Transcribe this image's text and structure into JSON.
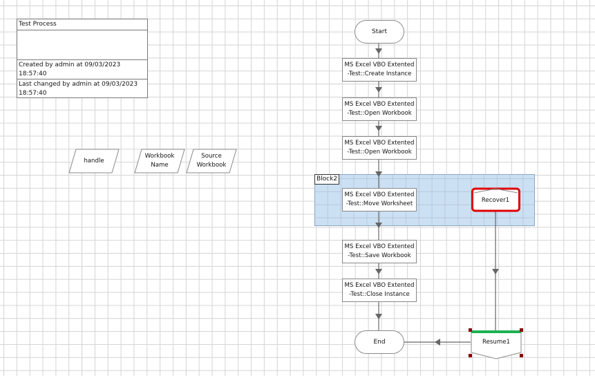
{
  "info": {
    "title": "Test Process",
    "description": "",
    "created": "Created by admin at 09/03/2023 18:57:40",
    "changed": "Last changed by admin at 09/03/2023 18:57:40"
  },
  "data_items": [
    {
      "label": "handle"
    },
    {
      "label": "Workbook Name"
    },
    {
      "label": "Source Workbook"
    }
  ],
  "flow": {
    "start": "Start",
    "actions": [
      "MS Excel VBO Extented -Test::Create Instance",
      "MS Excel VBO Extented -Test::Open Workbook",
      "MS Excel VBO Extented -Test::Open Workbook",
      "MS Excel VBO Extented -Test::Move Worksheet",
      "MS Excel VBO Extented -Test::Save Workbook",
      "MS Excel VBO Extented -Test::Close Instance"
    ],
    "end": "End",
    "block_label": "Block2",
    "recover": "Recover1",
    "resume": "Resume1"
  },
  "colors": {
    "block": "#cce0f3",
    "selected": "#e00000",
    "resume_bar": "#1db152"
  }
}
